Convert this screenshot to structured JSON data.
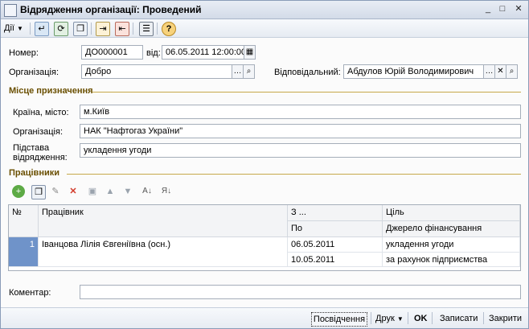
{
  "window": {
    "title": "Відрядження організації: Проведений",
    "controls": {
      "minimize": "_",
      "maximize": "□",
      "close": "✕"
    }
  },
  "toolbar": {
    "actions_label": "Дії",
    "icons": [
      "enter-field-icon",
      "refresh-icon",
      "copy-icon",
      "post-icon",
      "unpost-icon",
      "list-icon",
      "help-icon"
    ]
  },
  "header": {
    "number_label": "Номер:",
    "number_value": "ДО000001",
    "date_label": "від:",
    "date_value": "06.05.2011 12:00:00",
    "org_label": "Організація:",
    "org_value": "Добро",
    "responsible_label": "Відповідальний:",
    "responsible_value": "Абдулов Юрій Володимирович"
  },
  "destination": {
    "section_title": "Місце призначення",
    "country_label": "Країна, місто:",
    "country_value": "м.Київ",
    "org_label": "Організація:",
    "org_value": "НАК \"Нафтогаз України\"",
    "basis_label": "Підстава відрядження:",
    "basis_value": "укладення угоди"
  },
  "workers": {
    "section_title": "Працівники",
    "columns": {
      "num": "№",
      "worker": "Працівник",
      "from": "З ...",
      "to": "По",
      "purpose": "Ціль",
      "funding": "Джерело фінансування"
    },
    "rows": [
      {
        "num": "1",
        "worker": "Іванцова Лілія Євгеніївна (осн.)",
        "from": "06.05.2011",
        "to": "10.05.2011",
        "purpose": "укладення угоди",
        "funding": "за рахунок підприємства"
      }
    ]
  },
  "comment": {
    "label": "Коментар:",
    "value": ""
  },
  "footer": {
    "certificate": "Посвідчення",
    "print": "Друк",
    "ok": "OK",
    "save": "Записати",
    "close": "Закрити"
  }
}
